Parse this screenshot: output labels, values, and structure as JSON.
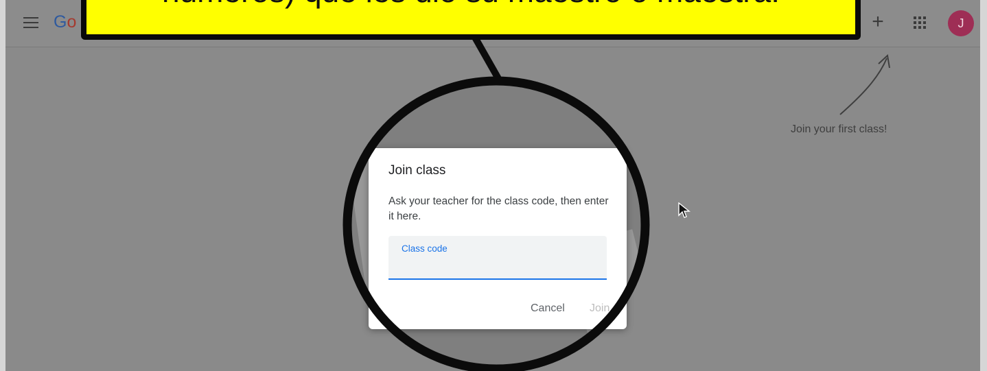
{
  "header": {
    "logo_part1": "G",
    "logo_part2": "o",
    "avatar_letter": "J"
  },
  "callout": {
    "text": "números) que les dio su maestro o maestra."
  },
  "hint": {
    "text": "Join your first class!"
  },
  "dialog": {
    "title": "Join class",
    "body": "Ask your teacher for the class code, then enter it here.",
    "field_label": "Class code",
    "field_value": "",
    "cancel_label": "Cancel",
    "join_label": "Join"
  },
  "icons": [
    "menu-icon",
    "add-icon",
    "apps-icon",
    "arrow-icon",
    "cursor-icon"
  ],
  "colors": {
    "callout_fill": "#ffff00",
    "accent": "#1a73e8",
    "avatar": "#9e2e55"
  }
}
